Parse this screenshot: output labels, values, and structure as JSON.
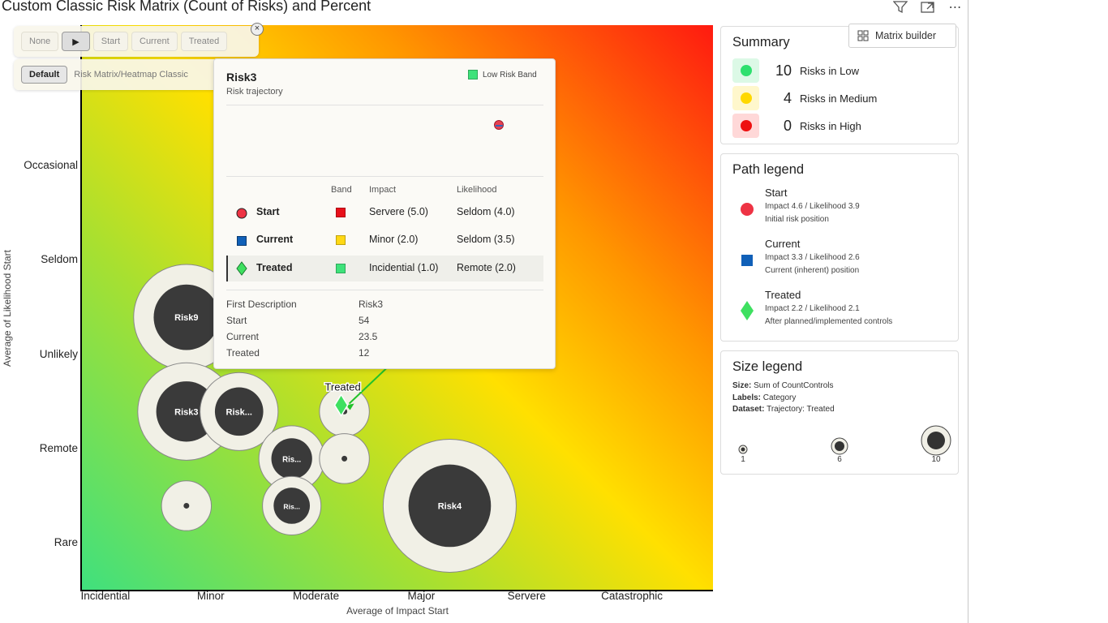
{
  "header": {
    "title": "Custom Classic Risk Matrix (Count of Risks) and Percent"
  },
  "toolbar": {
    "buttons": [
      "None",
      "▶",
      "Start",
      "Current",
      "Treated"
    ],
    "close": "×",
    "default_label": "Default",
    "path_label": "Risk Matrix/Heatmap Classic"
  },
  "tooltip": {
    "title": "Risk3",
    "subtitle": "Risk trajectory",
    "band_label": "Low Risk Band",
    "headers": {
      "band": "Band",
      "impact": "Impact",
      "likelihood": "Likelihood"
    },
    "rows": [
      {
        "name": "Start",
        "band_color": "#e8101a",
        "impact": "Servere (5.0)",
        "likelihood": "Seldom (4.0)"
      },
      {
        "name": "Current",
        "band_color": "#ffd814",
        "impact": "Minor (2.0)",
        "likelihood": "Seldom (3.5)"
      },
      {
        "name": "Treated",
        "band_color": "#3ee27a",
        "impact": "Incidential (1.0)",
        "likelihood": "Remote (2.0)"
      }
    ],
    "details": [
      {
        "label": "First Description",
        "value": "Risk3"
      },
      {
        "label": "Start",
        "value": "54"
      },
      {
        "label": "Current",
        "value": "23.5"
      },
      {
        "label": "Treated",
        "value": "12"
      }
    ]
  },
  "summary": {
    "title": "Summary",
    "matrix_builder_label": "Matrix builder",
    "items": [
      {
        "count": "10",
        "label": "Risks in Low",
        "color": "#2ee06e",
        "bg": "#dcf9e6"
      },
      {
        "count": "4",
        "label": "Risks in Medium",
        "color": "#ffd800",
        "bg": "#fff7cc"
      },
      {
        "count": "0",
        "label": "Risks in High",
        "color": "#ee1010",
        "bg": "#ffd8d8"
      }
    ]
  },
  "path_legend": {
    "title": "Path legend",
    "items": [
      {
        "name": "Start",
        "line1": "Impact 4.6 / Likelihood 3.9",
        "line2": "Initial risk position",
        "icon": "circle-icon",
        "color": "#ee3344"
      },
      {
        "name": "Current",
        "line1": "Impact 3.3 / Likelihood 2.6",
        "line2": "Current (inherent) position",
        "icon": "square-icon",
        "color": "#1060b8"
      },
      {
        "name": "Treated",
        "line1": "Impact 2.2 / Likelihood 2.1",
        "line2": "After planned/implemented controls",
        "icon": "diamond-icon",
        "color": "#3ee060"
      }
    ]
  },
  "size_legend": {
    "title": "Size legend",
    "lines": [
      {
        "key": "Size:",
        "value": "Sum of CountControls"
      },
      {
        "key": "Labels:",
        "value": "Category"
      },
      {
        "key": "Dataset:",
        "value": "Trajectory: Treated"
      }
    ],
    "sizes": [
      "1",
      "6",
      "10"
    ]
  },
  "chart_data": {
    "type": "scatter",
    "title": "Custom Classic Risk Matrix (Count of Risks) and Percent",
    "xlabel": "Average of Impact Start",
    "ylabel": "Average of Likelihood Start",
    "x_categories": [
      "Incidential",
      "Minor",
      "Moderate",
      "Major",
      "Servere",
      "Catastrophic"
    ],
    "y_categories": [
      "Rare",
      "Remote",
      "Unlikely",
      "Seldom",
      "Occasional"
    ],
    "xlim": [
      0.5,
      6.5
    ],
    "ylim": [
      0.5,
      6.5
    ],
    "grid": false,
    "bubbles": [
      {
        "label": "Risk9",
        "x": 1.5,
        "y": 3.4,
        "size": 6
      },
      {
        "label": "Risk3",
        "x": 1.5,
        "y": 2.4,
        "size": 5
      },
      {
        "label": "Risk...",
        "x": 2.0,
        "y": 2.4,
        "size": 3
      },
      {
        "label": "Ris...",
        "x": 2.5,
        "y": 1.9,
        "size": 2
      },
      {
        "label": "Ris...",
        "x": 2.5,
        "y": 1.4,
        "size": 1.5
      },
      {
        "label": "Risk4",
        "x": 4.0,
        "y": 1.4,
        "size": 10
      },
      {
        "label": "",
        "x": 1.5,
        "y": 1.4,
        "size": 1
      },
      {
        "label": "",
        "x": 3.0,
        "y": 2.4,
        "size": 1
      },
      {
        "label": "",
        "x": 3.0,
        "y": 1.9,
        "size": 1
      }
    ],
    "trajectory": {
      "risk": "Risk3",
      "start": {
        "label": "Start",
        "x": 4.7,
        "y": 4.03
      },
      "current_toward": {
        "x": 3.75,
        "y": 3.23
      },
      "treated": {
        "label": "Treated",
        "x": 3.0,
        "y": 2.45
      }
    }
  }
}
